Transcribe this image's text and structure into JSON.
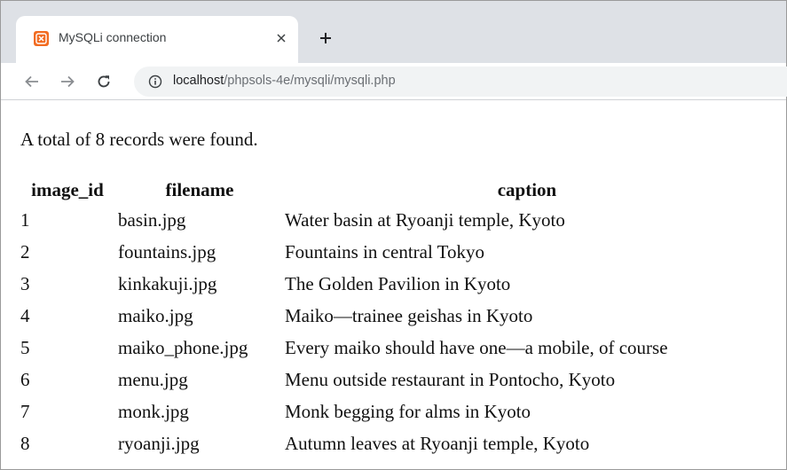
{
  "browser": {
    "tab": {
      "favicon": "xampp-logo-icon",
      "title": "MySQLi connection",
      "close_glyph": "✕"
    },
    "new_tab_glyph": "+",
    "toolbar": {
      "back_icon": "arrow-left-icon",
      "forward_icon": "arrow-right-icon",
      "reload_icon": "reload-icon",
      "site_info_icon": "info-circle-icon",
      "url_host": "localhost",
      "url_path": "/phpsols-4e/mysqli/mysqli.php"
    }
  },
  "page": {
    "summary": "A total of 8 records were found.",
    "table": {
      "headers": [
        "image_id",
        "filename",
        "caption"
      ],
      "rows": [
        [
          "1",
          "basin.jpg",
          "Water basin at Ryoanji temple, Kyoto"
        ],
        [
          "2",
          "fountains.jpg",
          "Fountains in central Tokyo"
        ],
        [
          "3",
          "kinkakuji.jpg",
          "The Golden Pavilion in Kyoto"
        ],
        [
          "4",
          "maiko.jpg",
          "Maiko—trainee geishas in Kyoto"
        ],
        [
          "5",
          "maiko_phone.jpg",
          "Every maiko should have one—a mobile, of course"
        ],
        [
          "6",
          "menu.jpg",
          "Menu outside restaurant in Pontocho, Kyoto"
        ],
        [
          "7",
          "monk.jpg",
          "Monk begging for alms in Kyoto"
        ],
        [
          "8",
          "ryoanji.jpg",
          "Autumn leaves at Ryoanji temple, Kyoto"
        ]
      ]
    }
  },
  "colors": {
    "tab_strip": "#dee1e6",
    "omnibox": "#f1f3f4",
    "favicon": "#f26b20",
    "url_path": "#6b6f74"
  }
}
